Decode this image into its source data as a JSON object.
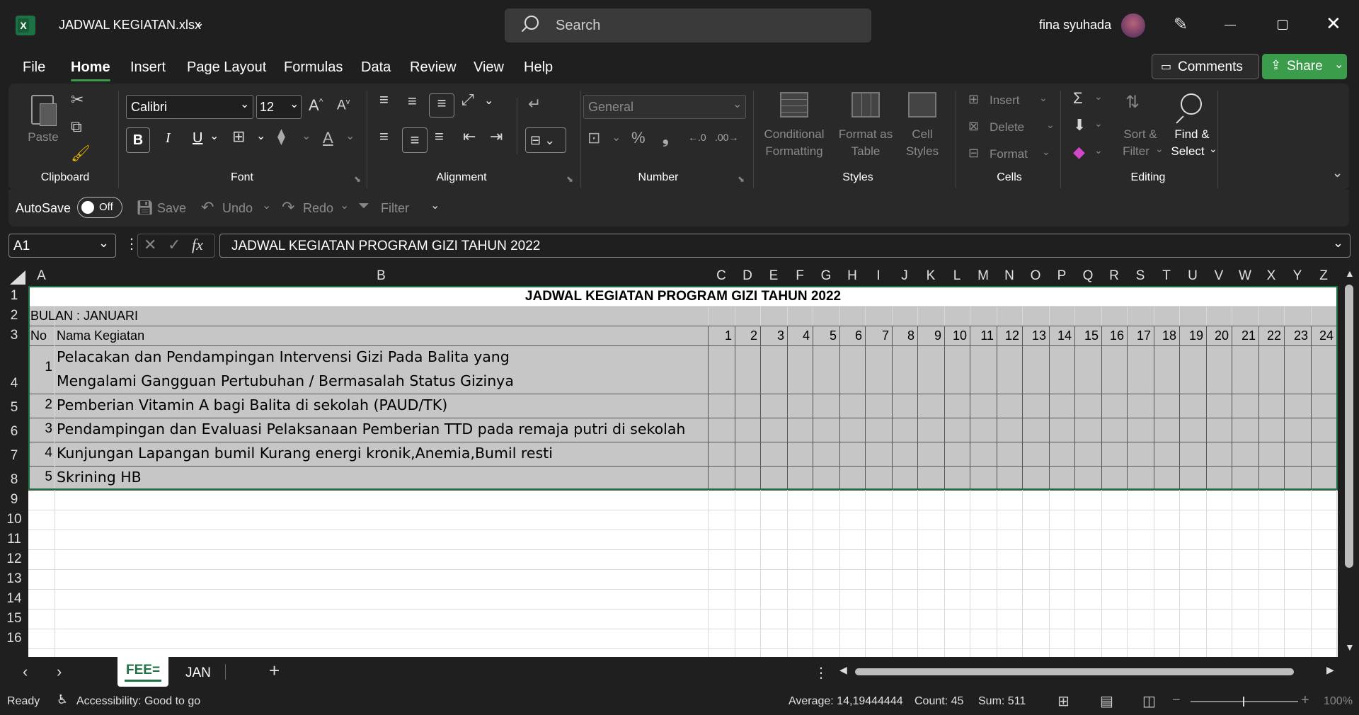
{
  "title": {
    "file_name": "JADWAL KEGIATAN.xlsx",
    "search_placeholder": "Search",
    "user_name": "fina syuhada"
  },
  "menu": {
    "tabs": [
      "File",
      "Home",
      "Insert",
      "Page Layout",
      "Formulas",
      "Data",
      "Review",
      "View",
      "Help"
    ],
    "active": "Home",
    "comments_label": "Comments",
    "share_label": "Share"
  },
  "ribbon": {
    "clipboard": {
      "paste": "Paste",
      "group": "Clipboard"
    },
    "font": {
      "name": "Calibri",
      "size": "12",
      "group": "Font",
      "bold": "B",
      "italic": "I",
      "underline": "U",
      "color_letter": "A"
    },
    "alignment": {
      "group": "Alignment"
    },
    "number": {
      "format": "General",
      "group": "Number"
    },
    "styles": {
      "conditional1": "Conditional",
      "conditional2": "Formatting",
      "format_as1": "Format as",
      "format_as2": "Table",
      "cell1": "Cell",
      "cell2": "Styles",
      "group": "Styles"
    },
    "cells": {
      "insert": "Insert",
      "delete": "Delete",
      "format": "Format",
      "group": "Cells"
    },
    "editing": {
      "sort1": "Sort &",
      "sort2": "Filter",
      "find1": "Find &",
      "find2": "Select",
      "group": "Editing"
    }
  },
  "qat": {
    "autosave": "AutoSave",
    "autosave_state": "Off",
    "save": "Save",
    "undo": "Undo",
    "redo": "Redo",
    "filter": "Filter"
  },
  "formula_bar": {
    "name_box": "A1",
    "fx": "fx",
    "content": "JADWAL KEGIATAN PROGRAM GIZI TAHUN 2022"
  },
  "sheet": {
    "column_headers": [
      "A",
      "B",
      "C",
      "D",
      "E",
      "F",
      "G",
      "H",
      "I",
      "J",
      "K",
      "L",
      "M",
      "N",
      "O",
      "P",
      "Q",
      "R",
      "S",
      "T",
      "U",
      "V",
      "W",
      "X",
      "Y",
      "Z"
    ],
    "row_headers": [
      "1",
      "2",
      "3",
      "4",
      "5",
      "6",
      "7",
      "8",
      "9",
      "10",
      "11",
      "12",
      "13",
      "14",
      "15",
      "16"
    ],
    "title": "JADWAL KEGIATAN PROGRAM GIZI TAHUN 2022",
    "month": "BULAN : JANUARI",
    "col_no": "No",
    "col_name": "Nama Kegiatan",
    "days": [
      "1",
      "2",
      "3",
      "4",
      "5",
      "6",
      "7",
      "8",
      "9",
      "10",
      "11",
      "12",
      "13",
      "14",
      "15",
      "16",
      "17",
      "18",
      "19",
      "20",
      "21",
      "22",
      "23",
      "24"
    ],
    "activities": [
      {
        "no": "1",
        "lines": [
          "Pelacakan dan Pendampingan Intervensi Gizi Pada Balita yang",
          "Mengalami Gangguan Pertubuhan / Bermasalah Status Gizinya"
        ]
      },
      {
        "no": "2",
        "lines": [
          "Pemberian Vitamin A bagi Balita di sekolah (PAUD/TK)"
        ]
      },
      {
        "no": "3",
        "lines": [
          "Pendampingan dan Evaluasi Pelaksanaan Pemberian TTD pada remaja putri di sekolah"
        ]
      },
      {
        "no": "4",
        "lines": [
          "Kunjungan Lapangan bumil Kurang energi kronik,Anemia,Bumil resti"
        ]
      },
      {
        "no": "5",
        "lines": [
          "Skrining HB"
        ]
      }
    ]
  },
  "tabs": {
    "sheets": [
      "FEE=",
      "JAN"
    ],
    "active": "FEE="
  },
  "status": {
    "ready": "Ready",
    "accessibility": "Accessibility: Good to go",
    "average": "Average: 14,19444444",
    "count": "Count: 45",
    "sum": "Sum: 511",
    "zoom": "100%"
  },
  "colors": {
    "accent_green": "#1e7145",
    "share_green": "#3b9c4b",
    "selection_fill": "#c6c6c6"
  }
}
